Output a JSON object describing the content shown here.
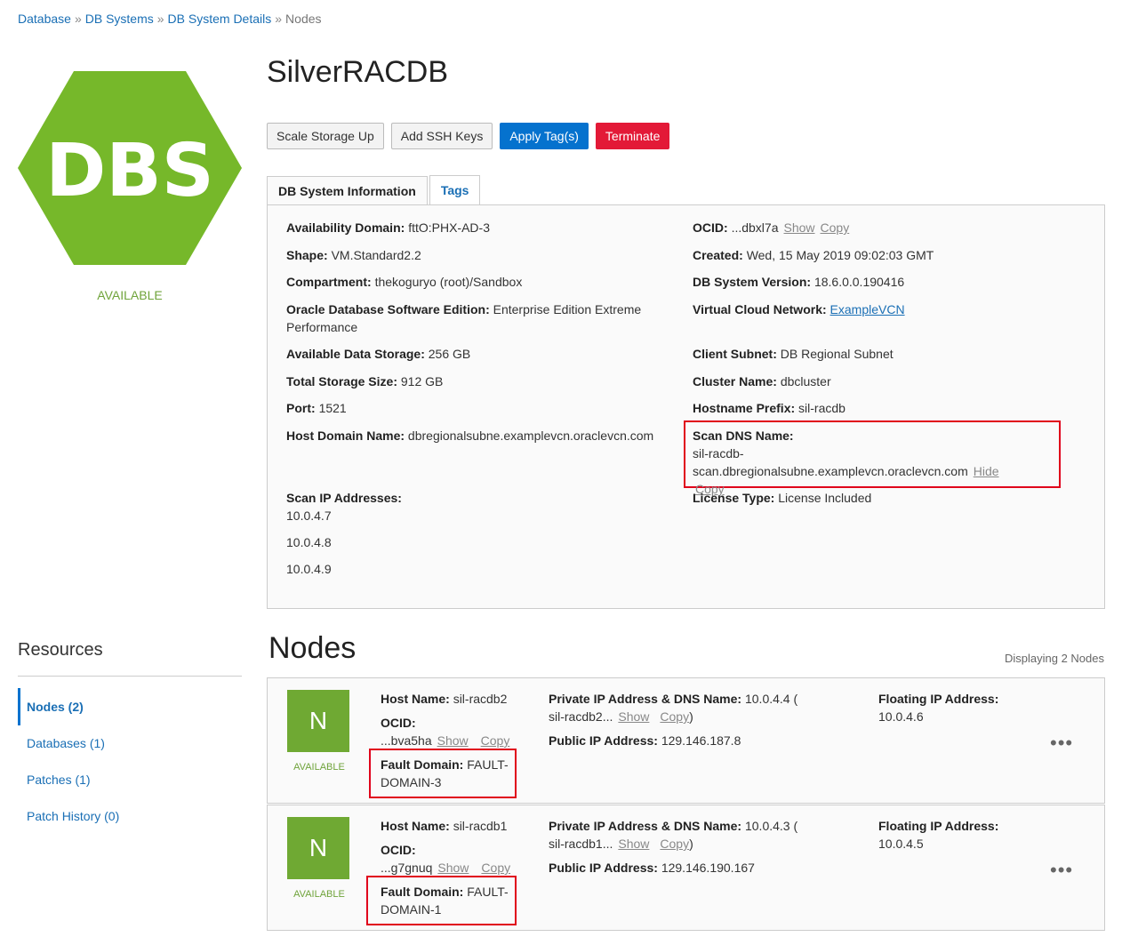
{
  "breadcrumb": {
    "items": [
      "Database",
      "DB Systems",
      "DB System Details"
    ],
    "separator": "»",
    "current": "Nodes"
  },
  "system": {
    "logo_text": "DBS",
    "logo_color": "#76b82a",
    "status": "AVAILABLE",
    "name": "SilverRACDB"
  },
  "actions": {
    "scale": "Scale Storage Up",
    "ssh": "Add SSH Keys",
    "tags": "Apply Tag(s)",
    "terminate": "Terminate"
  },
  "tabs": {
    "info": "DB System Information",
    "tags": "Tags"
  },
  "info": {
    "ad_label": "Availability Domain:",
    "ad": "fttO:PHX-AD-3",
    "shape_label": "Shape:",
    "shape": "VM.Standard2.2",
    "comp_label": "Compartment:",
    "comp": "thekoguryo (root)/Sandbox",
    "edition_label": "Oracle Database Software Edition:",
    "edition_a": "Enterprise Edition Extreme",
    "edition_b": "Performance",
    "storage_label": "Available Data Storage:",
    "storage": "256 GB",
    "total_label": "Total Storage Size:",
    "total": "912 GB",
    "port_label": "Port:",
    "port": "1521",
    "hostdomain_label": "Host Domain Name:",
    "hostdomain": "dbregionalsubne.examplevcn.oraclevcn.com",
    "scanip_label": "Scan IP Addresses:",
    "scanip": [
      "10.0.4.7",
      "10.0.4.8",
      "10.0.4.9"
    ],
    "ocid_label": "OCID:",
    "ocid": "...dbxl7a",
    "show": "Show",
    "copy": "Copy",
    "created_label": "Created:",
    "created": "Wed, 15 May 2019 09:02:03 GMT",
    "version_label": "DB System Version:",
    "version": "18.6.0.0.190416",
    "vcn_label": "Virtual Cloud Network:",
    "vcn": "ExampleVCN",
    "subnet_label": "Client Subnet:",
    "subnet": "DB Regional Subnet",
    "cluster_label": "Cluster Name:",
    "cluster": "dbcluster",
    "prefix_label": "Hostname Prefix:",
    "prefix": "sil-racdb",
    "scandns_label": "Scan DNS Name:",
    "scandns": "sil-racdb-scan.dbregionalsubne.examplevcn.oraclevcn.com",
    "hide": "Hide",
    "license_label": "License Type:",
    "license": "License Included"
  },
  "resources": {
    "title": "Resources",
    "items": [
      "Nodes (2)",
      "Databases (1)",
      "Patches (1)",
      "Patch History (0)"
    ]
  },
  "nodes": {
    "title": "Nodes",
    "count": "Displaying 2 Nodes",
    "labels": {
      "host": "Host Name:",
      "ocid": "OCID:",
      "fault": "Fault Domain:",
      "private": "Private IP Address & DNS Name:",
      "public": "Public IP Address:",
      "floating": "Floating IP Address:",
      "show": "Show",
      "copy": "Copy",
      "paren_open": "(",
      "paren_close": ")"
    },
    "list": [
      {
        "letter": "N",
        "status": "AVAILABLE",
        "host": "sil-racdb2",
        "ocid": "...bva5ha",
        "fault_a": "FAULT-",
        "fault_b": "DOMAIN-3",
        "private_ip": "10.0.4.4",
        "dns": "sil-racdb2...",
        "public_ip": "129.146.187.8",
        "floating": "10.0.4.6"
      },
      {
        "letter": "N",
        "status": "AVAILABLE",
        "host": "sil-racdb1",
        "ocid": "...g7gnuq",
        "fault_a": "FAULT-",
        "fault_b": "DOMAIN-1",
        "private_ip": "10.0.4.3",
        "dns": "sil-racdb1...",
        "public_ip": "129.146.190.167",
        "floating": "10.0.4.5"
      }
    ]
  }
}
